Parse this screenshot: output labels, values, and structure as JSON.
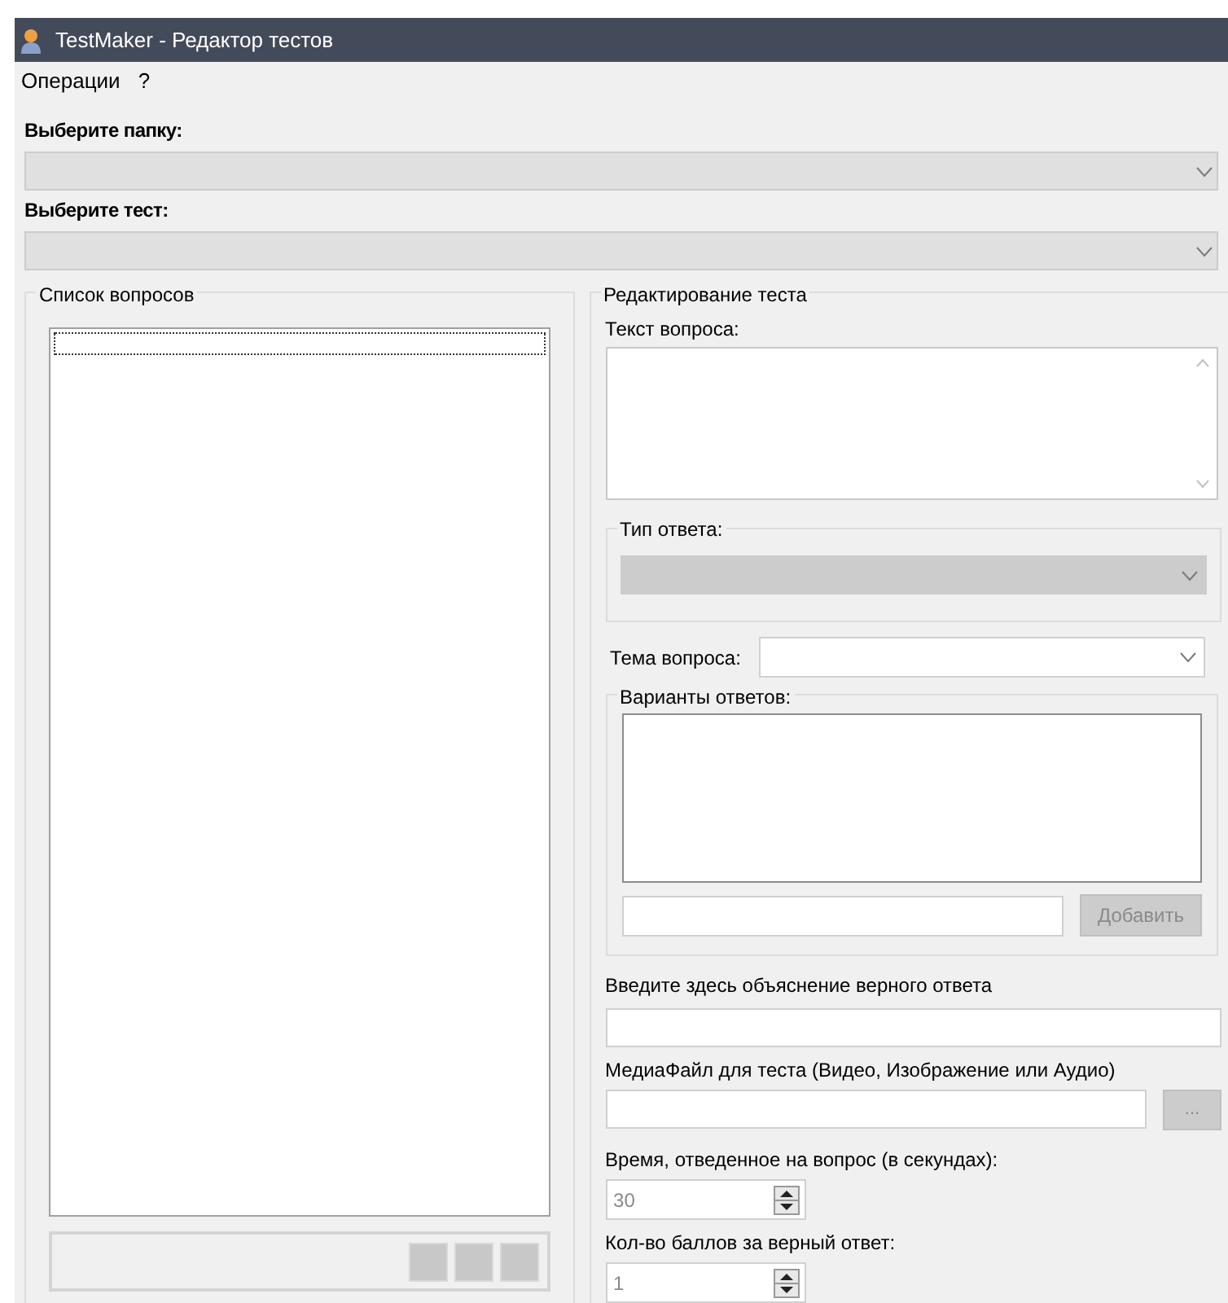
{
  "window": {
    "title": "TestMaker - Редактор тестов"
  },
  "menu": [
    "Операции",
    "?"
  ],
  "folder": {
    "label": "Выберите папку:",
    "disabled": true
  },
  "test": {
    "label": "Выберите тест:",
    "disabled": true
  },
  "questions": {
    "legend": "Список вопросов",
    "focused": true,
    "toolbar_buttons": [
      {
        "disabled": true
      },
      {
        "disabled": true
      },
      {
        "disabled": true
      }
    ]
  },
  "editor": {
    "legend": "Редактирование теста",
    "question_text_label": "Текст вопроса:",
    "answer_type": {
      "legend": "Тип ответа:",
      "disabled": true
    },
    "topic": {
      "label": "Тема вопроса:",
      "disabled": false
    },
    "variants": {
      "legend": "Варианты ответов:",
      "add_button": {
        "label": "Добавить",
        "disabled": true
      }
    },
    "explanation_label": "Введите здесь объяснение верного ответа",
    "media": {
      "label": "МедиаФайл для теста (Видео, Изображение или Аудио)",
      "browse": {
        "label": "...",
        "disabled": true
      }
    },
    "time": {
      "label": "Время, отведенное на вопрос (в секундах):",
      "value": "30",
      "disabled": true
    },
    "points": {
      "label": "Кол-во баллов за верный ответ:",
      "value": "1",
      "disabled": true
    }
  }
}
